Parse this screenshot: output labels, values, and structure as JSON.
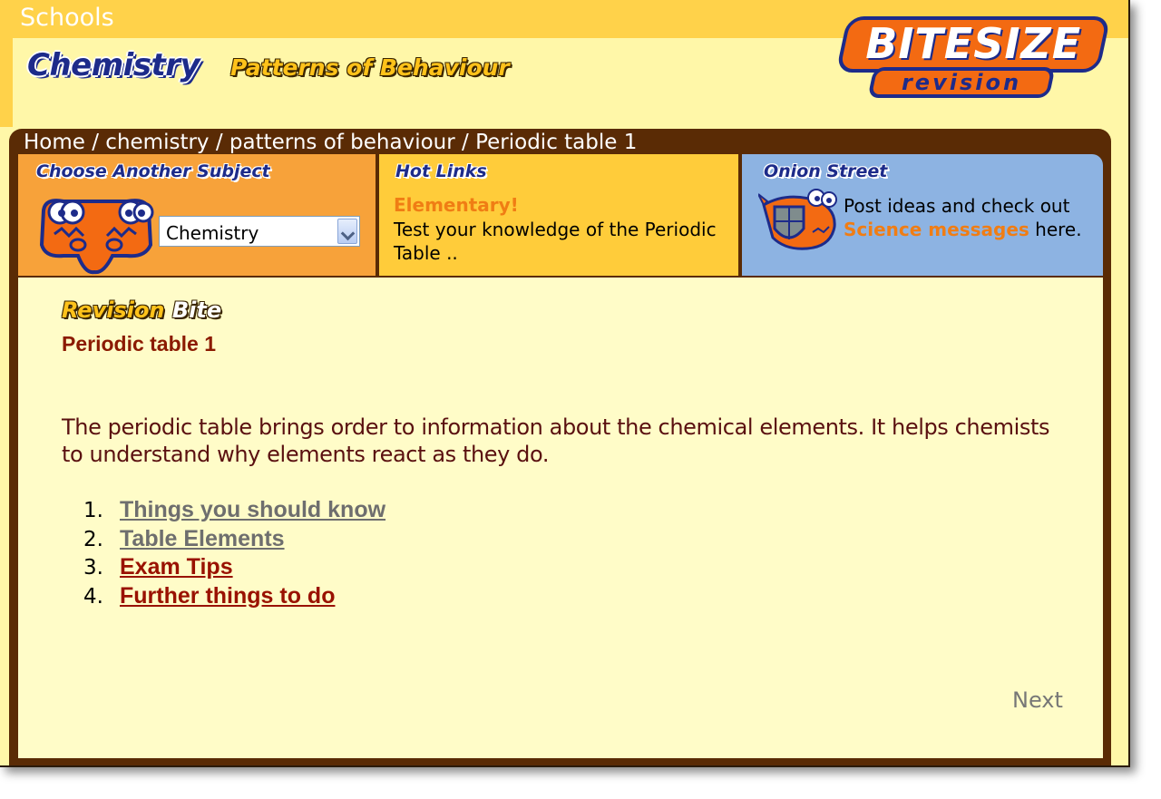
{
  "site": {
    "section_label": "Schools",
    "subject_title": "Chemistry",
    "topic_title": "Patterns of Behaviour",
    "logo_main": "BITESIZE",
    "logo_sub": "revision"
  },
  "breadcrumb": "Home / chemistry / patterns of behaviour / Periodic table 1",
  "panels": {
    "subject": {
      "heading": "Choose Another Subject",
      "selected": "Chemistry"
    },
    "hotlinks": {
      "heading": "Hot Links",
      "link_title": "Elementary!",
      "link_text": "Test your knowledge of the Periodic Table .."
    },
    "onion": {
      "heading": "Onion Street",
      "text_before": "Post ideas and check out",
      "link": "Science messages",
      "text_after": "here."
    }
  },
  "main": {
    "revision_word1": "Revision",
    "revision_word2": "Bite",
    "page_title": "Periodic table 1",
    "intro": "The periodic table brings order to information about the chemical elements. It helps chemists to understand why elements react as they do.",
    "topics": [
      {
        "num": "1.",
        "label": "Things you should know",
        "state": "visited"
      },
      {
        "num": "2.",
        "label": "Table Elements",
        "state": "visited"
      },
      {
        "num": "3.",
        "label": "Exam Tips",
        "state": "unvisited"
      },
      {
        "num": "4.",
        "label": "Further things to do",
        "state": "unvisited"
      }
    ],
    "next_label": "Next"
  },
  "colors": {
    "page_bg": "#fff7a8",
    "frame_brown": "#5a2b05",
    "subject_panel": "#f7a23a",
    "hotlinks_panel": "#ffcc3a",
    "onion_panel": "#8db3e2",
    "heading_blue": "#1d2b8a",
    "accent_orange": "#f07d14",
    "title_red": "#8b1a00"
  },
  "icons": {
    "subject_mascot": "orange-monster-icon",
    "onion_mascot": "fish-shield-icon",
    "select_arrow": "chevron-down-icon"
  }
}
